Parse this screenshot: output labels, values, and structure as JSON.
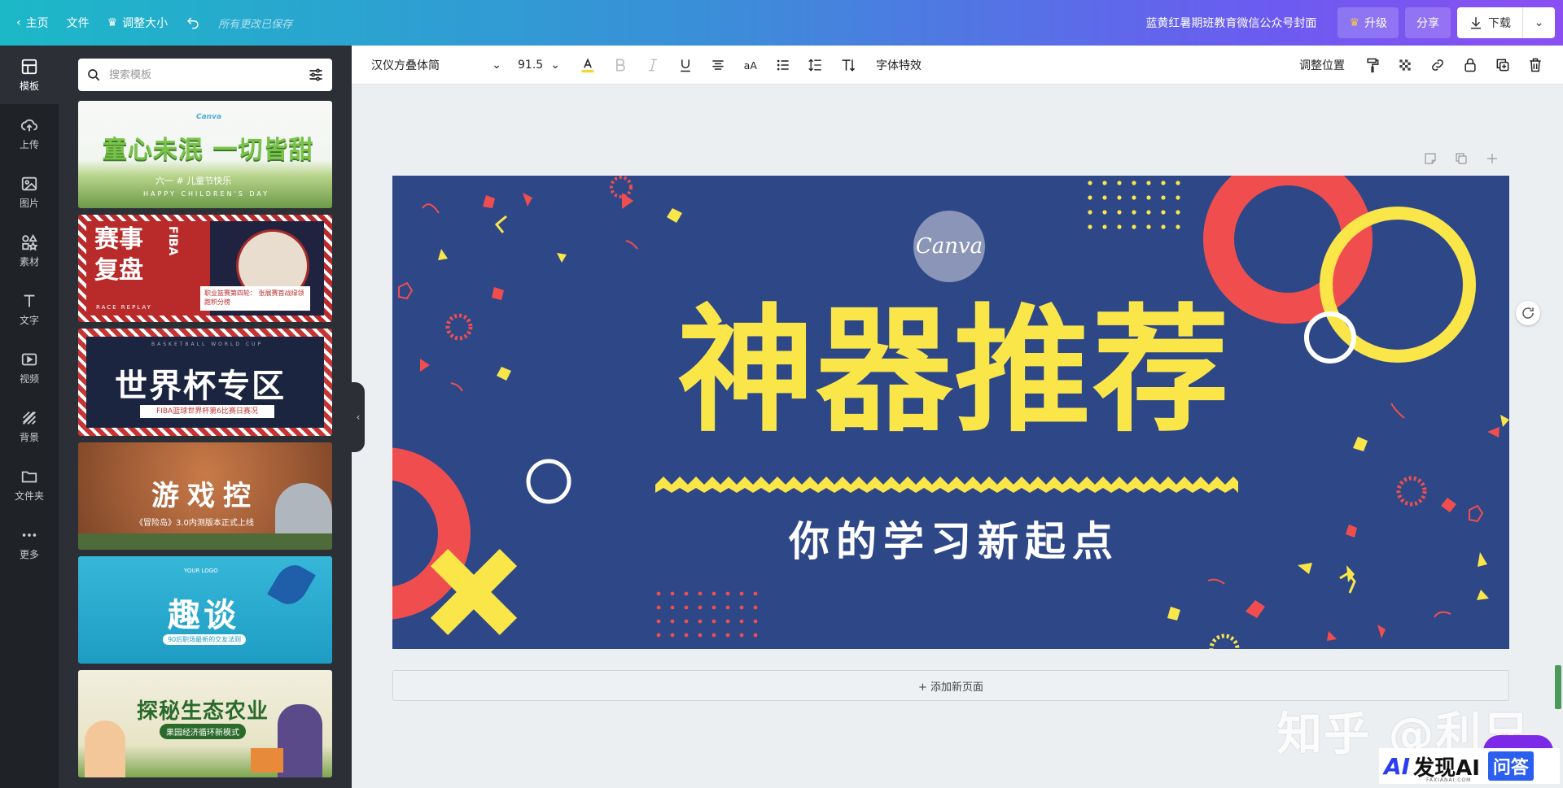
{
  "topbar": {
    "home": "主页",
    "file": "文件",
    "resize": "调整大小",
    "saved": "所有更改已保存",
    "doc_title": "蓝黄红暑期班教育微信公众号封面",
    "upgrade": "升级",
    "share": "分享",
    "download": "下载"
  },
  "rail": [
    {
      "label": "模板",
      "icon": "template-icon"
    },
    {
      "label": "上传",
      "icon": "upload-icon"
    },
    {
      "label": "图片",
      "icon": "image-icon"
    },
    {
      "label": "素材",
      "icon": "elements-icon"
    },
    {
      "label": "文字",
      "icon": "text-icon"
    },
    {
      "label": "视频",
      "icon": "video-icon"
    },
    {
      "label": "背景",
      "icon": "background-icon"
    },
    {
      "label": "文件夹",
      "icon": "folder-icon"
    },
    {
      "label": "更多",
      "icon": "more-icon"
    }
  ],
  "search": {
    "placeholder": "搜索模板"
  },
  "templates": [
    {
      "title": "童心未泯 一切皆甜",
      "sub": "六一 # 儿童节快乐",
      "sub2": "HAPPY CHILDREN'S DAY",
      "logo": "Canva"
    },
    {
      "title_line1": "赛事",
      "title_line2": "复盘",
      "side": "FIBA",
      "note": "职业篮赛第四轮： 张展赛首战绿领跑积分榜",
      "foot": "RACE REPLAY"
    },
    {
      "title": "世界杯专区",
      "sub": "FIBA篮球世界杯第6比赛日赛况",
      "top": "BASKETBALL WORLD CUP"
    },
    {
      "title": "游戏控",
      "sub": "《冒险岛》3.0内测版本正式上线"
    },
    {
      "title": "趣谈",
      "sub": "90后职场最新的交友法则",
      "logo": "YOUR LOGO"
    },
    {
      "title": "探秘生态农业",
      "sub": "果园经济循环新模式"
    }
  ],
  "toolbar": {
    "font": "汉仪方叠体简",
    "size": "91.5",
    "effects": "字体特效",
    "position": "调整位置"
  },
  "canvas": {
    "logo": "Canva",
    "headline": "神器推荐",
    "subline": "你的学习新起点",
    "bg_color": "#2e4887",
    "accent_yellow": "#fbe64a",
    "accent_red": "#f04e4e"
  },
  "addpage": "+ 添加新页面",
  "watermark": "知乎 @利兄",
  "brand": {
    "mark": "AI",
    "name": "发现AI",
    "badge": "问答",
    "small": "FAXIANAI.COM"
  }
}
